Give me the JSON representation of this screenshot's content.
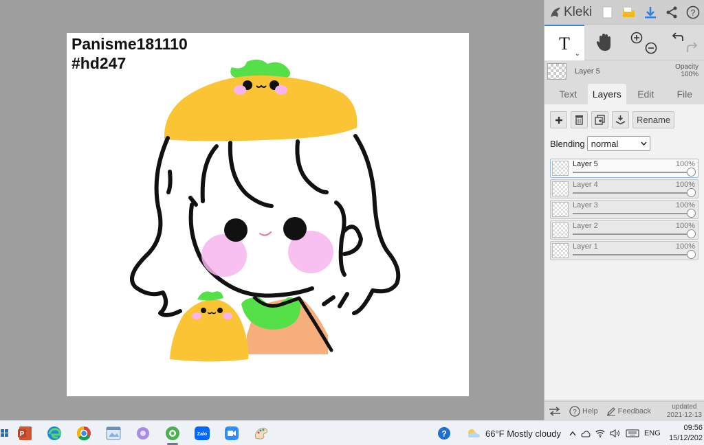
{
  "canvas": {
    "text_line1": "Panisme181110",
    "text_line2": "#hd247"
  },
  "app": {
    "name": "Kleki"
  },
  "layer_info": {
    "current_layer": "Layer 5",
    "opacity_label": "Opacity",
    "opacity_value": "100%"
  },
  "tabs": [
    {
      "label": "Text"
    },
    {
      "label": "Layers"
    },
    {
      "label": "Edit"
    },
    {
      "label": "File"
    }
  ],
  "layers_pane": {
    "rename_label": "Rename",
    "blending_label": "Blending",
    "blending_value": "normal",
    "layers": [
      {
        "name": "Layer 5",
        "opacity": "100%"
      },
      {
        "name": "Layer 4",
        "opacity": "100%"
      },
      {
        "name": "Layer 3",
        "opacity": "100%"
      },
      {
        "name": "Layer 2",
        "opacity": "100%"
      },
      {
        "name": "Layer 1",
        "opacity": "100%"
      }
    ]
  },
  "panel_bottom": {
    "help_label": "Help",
    "feedback_label": "Feedback",
    "updated_label": "updated",
    "updated_date": "2021-12-13"
  },
  "taskbar": {
    "weather": "66°F  Mostly cloudy",
    "language": "ENG",
    "time": "09:56",
    "date": "15/12/202"
  },
  "colors": {
    "accent_blue": "#3b7ed9",
    "hat_yellow": "#fbc435",
    "leaf_green": "#55e04a",
    "blush_pink": "#f7b4ef",
    "shirt_orange": "#f6ae7a"
  }
}
